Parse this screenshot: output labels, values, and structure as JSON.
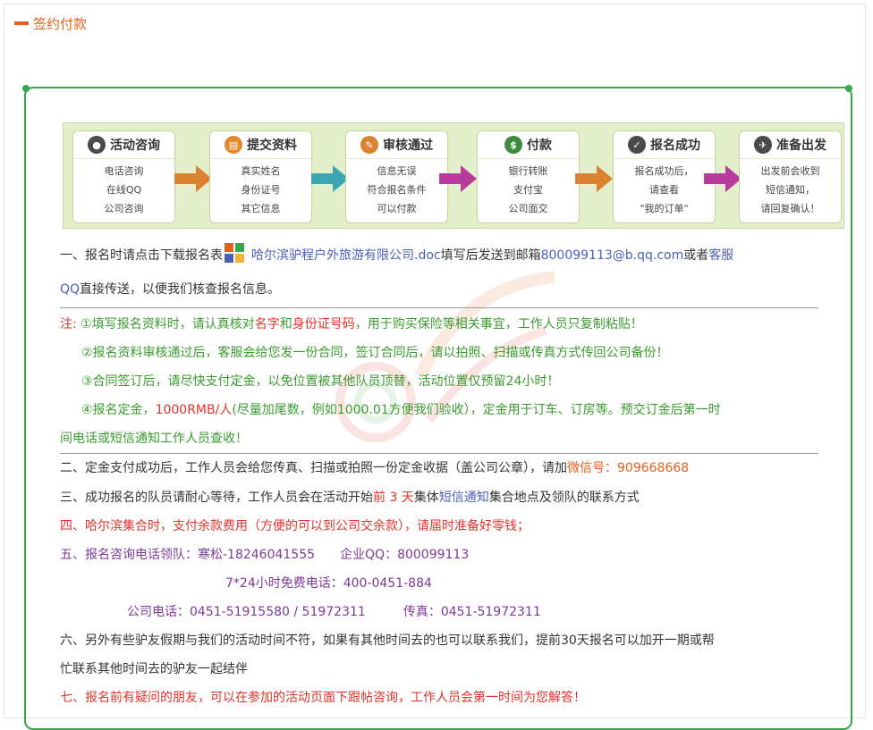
{
  "section": {
    "title": "签约付款"
  },
  "flow": {
    "steps": [
      {
        "title": "活动咨询",
        "icon": "person-icon",
        "lines": [
          "电话咨询",
          "在线QQ",
          "公司咨询"
        ]
      },
      {
        "title": "提交资料",
        "icon": "document-icon",
        "lines": [
          "真实姓名",
          "身份证号",
          "其它信息"
        ]
      },
      {
        "title": "审核通过",
        "icon": "edit-icon",
        "lines": [
          "信息无误",
          "符合报名条件",
          "可以付款"
        ]
      },
      {
        "title": "付款",
        "icon": "cash-icon",
        "lines": [
          "银行转账",
          "支付宝",
          "公司面交"
        ]
      },
      {
        "title": "报名成功",
        "icon": "check-icon",
        "lines": [
          "报名成功后，",
          "请查看",
          "\"我的订单\""
        ]
      },
      {
        "title": "准备出发",
        "icon": "plane-icon",
        "lines": [
          "出发前会收到",
          "短信通知，",
          "请回复确认！"
        ]
      }
    ]
  },
  "item1": {
    "prefix": "一、报名时请点击下载报名表",
    "file": "哈尔滨驴程户外旅游有限公司.doc",
    "mid": "填写后发送到邮箱",
    "email": "800099113@b.qq.com",
    "or": "或者",
    "kefu": "客服",
    "qq": "QQ",
    "suffix": "直接传送，以便我们核查报名信息。"
  },
  "notes": {
    "label": "注:",
    "n1a": "①填写报名资料时，请认真核对",
    "n1name": "名字",
    "n1and": "和",
    "n1id": "身份证号码",
    "n1b": "，用于购买保险等相关事宜，工作人员只复制粘贴！",
    "n2": "②报名资料审核通过后，客服会给您发一份合同，签订合同后，请以拍照、扫描或传真方式传回公司备份！",
    "n3": "③合同签订后，请尽快支付定金，以免位置被其他队员顶替，活动位置仅预留24小时！",
    "n4a": "④报名定金，",
    "n4amount": "1000RMB/人",
    "n4b": "(尽量加尾数，例如1000.01方便我们验收），定金用于订车、订房等。预交订金后第一时",
    "n4c": "间电话或短信通知工作人员查收！"
  },
  "item2": {
    "text": "二、定金支付成功后，工作人员会给您传真、扫描或拍照一份定金收据（盖公司公章），请加",
    "wx": "微信号：909668668"
  },
  "item3": {
    "a": "三、成功报名的队员请耐心等待，工作人员会在活动开始",
    "days": "前 3 天",
    "b": "集体",
    "sms": "短信通知",
    "c": "集合地点及领队的联系方式"
  },
  "item4": {
    "text": "四、哈尔滨集合时，支付余款费用（方便的可以到公司交余款），请届时准备好零钱；"
  },
  "item5": {
    "line1": "五、报名咨询电话领队：寒松-18246041555　　企业QQ：800099113",
    "line2": "7*24小时免费电话：400-0451-884",
    "line3": "公司电话：0451-51915580 / 51972311　　　传真：0451-51972311"
  },
  "item6": {
    "a": "六、另外有些驴友假期与我们的活动时间不符，如果有其他时间去的也可以联系我们，提前30天报名可以加开一期或帮",
    "b": "忙联系其他时间去的驴友一起结伴"
  },
  "item7": {
    "text": "七、报名前有疑问的朋友，可以在参加的活动页面下跟帖咨询，工作人员会第一时间为您解答！"
  },
  "colors": {
    "accent": "#e2621b",
    "border_green": "#38a64a",
    "link_blue": "#4b5fb6",
    "note_green": "#3b9a2f",
    "red": "#e2322b",
    "purple": "#7c3a96"
  }
}
